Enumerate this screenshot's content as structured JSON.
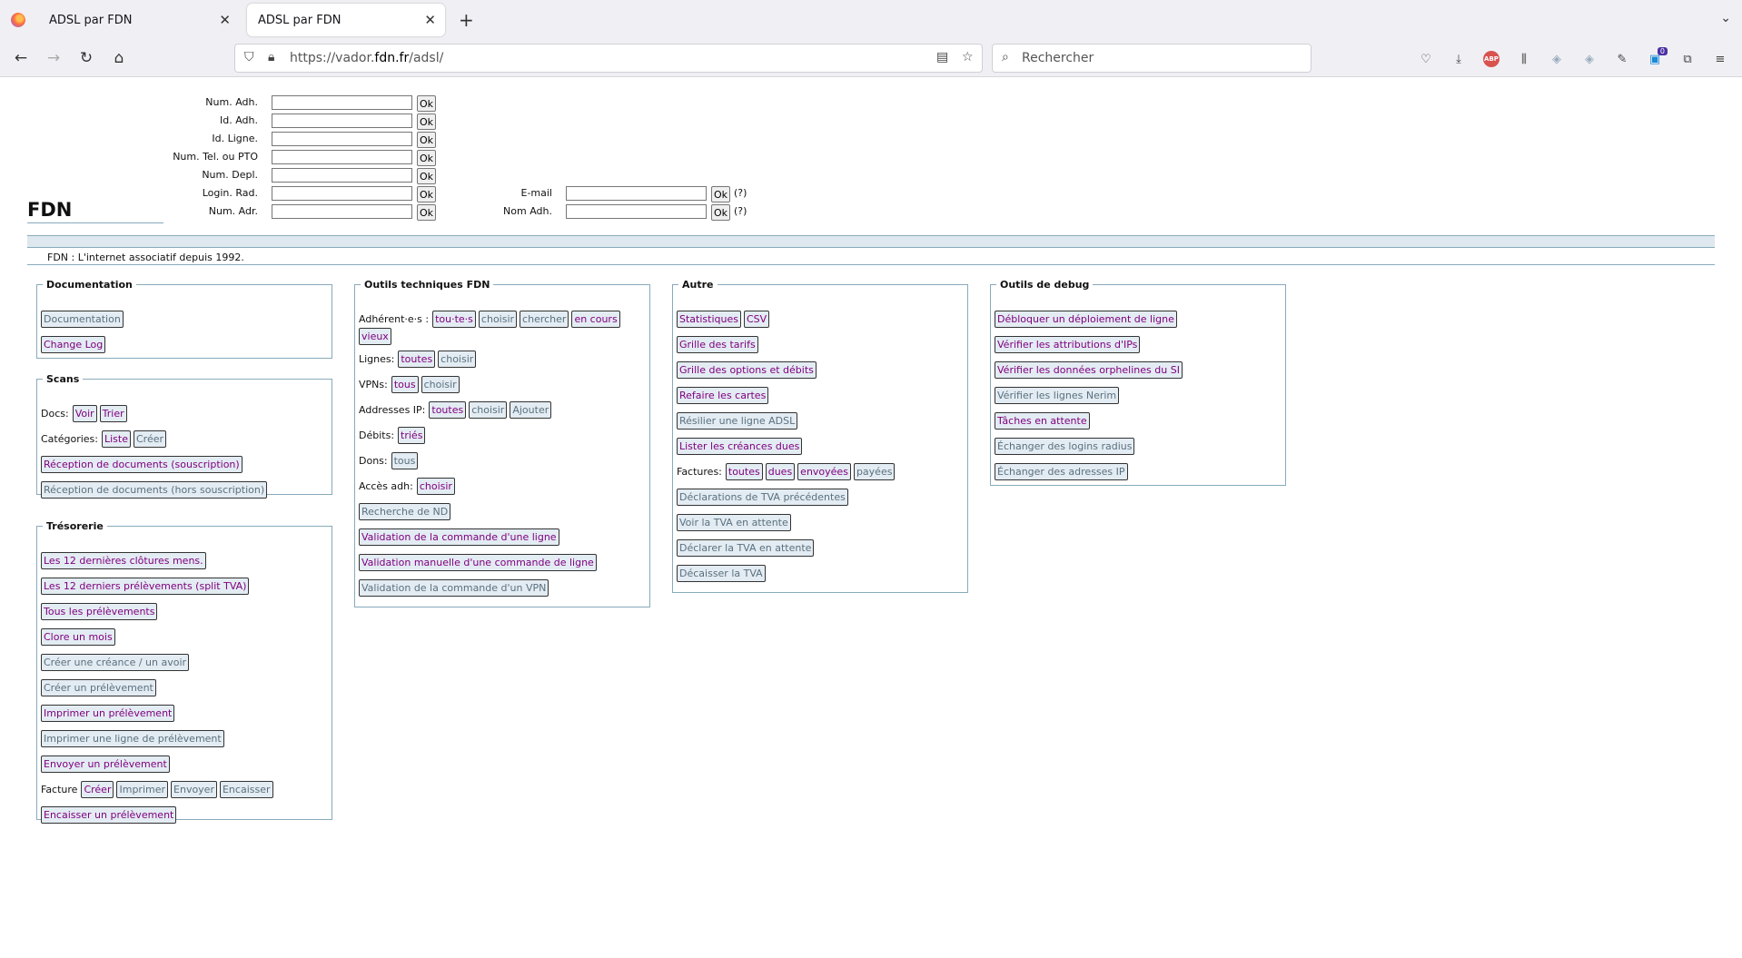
{
  "browser": {
    "tabs": [
      {
        "title": "ADSL par FDN",
        "active": false
      },
      {
        "title": "ADSL par FDN",
        "active": true
      }
    ],
    "url_prefix": "https://vador.",
    "url_domain": "fdn.fr",
    "url_path": "/adsl/",
    "search_placeholder": "Rechercher",
    "ext_badge": "0",
    "abp_label": "ABP"
  },
  "search_form": {
    "left_fields": [
      {
        "label": "Num. Adh.",
        "value": "",
        "ok": "Ok"
      },
      {
        "label": "Id. Adh.",
        "value": "",
        "ok": "Ok"
      },
      {
        "label": "Id. Ligne.",
        "value": "",
        "ok": "Ok"
      },
      {
        "label": "Num. Tel. ou PTO",
        "value": "",
        "ok": "Ok"
      },
      {
        "label": "Num. Depl.",
        "value": "",
        "ok": "Ok"
      },
      {
        "label": "Login. Rad.",
        "value": "",
        "ok": "Ok"
      },
      {
        "label": "Num. Adr.",
        "value": "",
        "ok": "Ok"
      }
    ],
    "right_fields": [
      {
        "label": "E-mail",
        "value": "",
        "ok": "Ok",
        "help": "(?)"
      },
      {
        "label": "Nom Adh.",
        "value": "",
        "ok": "Ok",
        "help": "(?)"
      }
    ]
  },
  "site": {
    "title": "FDN",
    "tagline": "FDN : L'internet associatif depuis 1992."
  },
  "sections": {
    "documentation": {
      "legend": "Documentation",
      "rows": [
        {
          "buttons": [
            {
              "label": "Documentation",
              "visited": false
            }
          ]
        },
        {
          "buttons": [
            {
              "label": "Change Log",
              "visited": true
            }
          ]
        }
      ]
    },
    "scans": {
      "legend": "Scans",
      "rows": [
        {
          "label": "Docs:",
          "buttons": [
            {
              "label": "Voir",
              "visited": true
            },
            {
              "label": "Trier",
              "visited": true
            }
          ]
        },
        {
          "label": "Catégories:",
          "buttons": [
            {
              "label": "Liste",
              "visited": true
            },
            {
              "label": "Créer",
              "visited": false
            }
          ]
        },
        {
          "buttons": [
            {
              "label": "Réception de documents (souscription)",
              "visited": true
            }
          ]
        },
        {
          "buttons": [
            {
              "label": "Réception de documents (hors souscription)",
              "visited": false
            }
          ]
        }
      ]
    },
    "tresorerie": {
      "legend": "Trésorerie",
      "rows": [
        {
          "buttons": [
            {
              "label": "Les 12 dernières clôtures mens.",
              "visited": true
            }
          ]
        },
        {
          "buttons": [
            {
              "label": "Les 12 derniers prélèvements (split TVA)",
              "visited": true
            }
          ]
        },
        {
          "buttons": [
            {
              "label": "Tous les prélèvements",
              "visited": true
            }
          ]
        },
        {
          "buttons": [
            {
              "label": "Clore un mois",
              "visited": true
            }
          ]
        },
        {
          "buttons": [
            {
              "label": "Créer une créance / un avoir",
              "visited": false
            }
          ]
        },
        {
          "buttons": [
            {
              "label": "Créer un prélèvement",
              "visited": false
            }
          ]
        },
        {
          "buttons": [
            {
              "label": "Imprimer un prélèvement",
              "visited": true
            }
          ]
        },
        {
          "buttons": [
            {
              "label": "Imprimer une ligne de prélèvement",
              "visited": false
            }
          ]
        },
        {
          "buttons": [
            {
              "label": "Envoyer un prélèvement",
              "visited": true
            }
          ]
        },
        {
          "label": "Facture",
          "buttons": [
            {
              "label": "Créer",
              "visited": true
            },
            {
              "label": "Imprimer",
              "visited": false
            },
            {
              "label": "Envoyer",
              "visited": false
            },
            {
              "label": "Encaisser",
              "visited": false
            }
          ]
        },
        {
          "buttons": [
            {
              "label": "Encaisser un prélèvement",
              "visited": true
            }
          ]
        }
      ]
    },
    "outils_techniques": {
      "legend": "Outils techniques FDN",
      "adherents_label": "Adhérent·e·s :",
      "adherents_buttons": [
        {
          "label": "tou·te·s",
          "visited": true
        },
        {
          "label": "choisir",
          "visited": false
        },
        {
          "label": "chercher",
          "visited": false
        },
        {
          "label": "en cours",
          "visited": true
        },
        {
          "label": "vieux",
          "visited": true
        }
      ],
      "rows": [
        {
          "label": "Lignes:",
          "buttons": [
            {
              "label": "toutes",
              "visited": true
            },
            {
              "label": "choisir",
              "visited": false
            }
          ]
        },
        {
          "label": "VPNs:",
          "buttons": [
            {
              "label": "tous",
              "visited": true
            },
            {
              "label": "choisir",
              "visited": false
            }
          ]
        },
        {
          "label": "Addresses IP:",
          "buttons": [
            {
              "label": "toutes",
              "visited": true
            },
            {
              "label": "choisir",
              "visited": false
            },
            {
              "label": "Ajouter",
              "visited": false
            }
          ]
        },
        {
          "label": "Débits:",
          "buttons": [
            {
              "label": "triés",
              "visited": true
            }
          ]
        },
        {
          "label": "Dons:",
          "buttons": [
            {
              "label": "tous",
              "visited": false
            }
          ]
        },
        {
          "label": "Accès adh:",
          "buttons": [
            {
              "label": "choisir",
              "visited": true
            }
          ]
        },
        {
          "buttons": [
            {
              "label": "Recherche de ND",
              "visited": false
            }
          ]
        },
        {
          "buttons": [
            {
              "label": "Validation de la commande d'une ligne",
              "visited": true
            }
          ]
        },
        {
          "buttons": [
            {
              "label": "Validation manuelle d'une commande de ligne",
              "visited": true
            }
          ]
        },
        {
          "buttons": [
            {
              "label": "Validation de la commande d'un VPN",
              "visited": false
            }
          ]
        }
      ]
    },
    "autre": {
      "legend": "Autre",
      "rows": [
        {
          "buttons": [
            {
              "label": "Statistiques",
              "visited": true
            },
            {
              "label": "CSV",
              "visited": true
            }
          ]
        },
        {
          "buttons": [
            {
              "label": "Grille des tarifs",
              "visited": true
            }
          ]
        },
        {
          "buttons": [
            {
              "label": "Grille des options et débits",
              "visited": true
            }
          ]
        },
        {
          "buttons": [
            {
              "label": "Refaire les cartes",
              "visited": true
            }
          ]
        },
        {
          "buttons": [
            {
              "label": "Résilier une ligne ADSL",
              "visited": false
            }
          ]
        },
        {
          "buttons": [
            {
              "label": "Lister les créances dues",
              "visited": true
            }
          ]
        },
        {
          "label": "Factures:",
          "buttons": [
            {
              "label": "toutes",
              "visited": true
            },
            {
              "label": "dues",
              "visited": true
            },
            {
              "label": "envoyées",
              "visited": true
            },
            {
              "label": "payées",
              "visited": false
            }
          ]
        },
        {
          "buttons": [
            {
              "label": "Déclarations de TVA précédentes",
              "visited": false
            }
          ]
        },
        {
          "buttons": [
            {
              "label": "Voir la TVA en attente",
              "visited": false
            }
          ]
        },
        {
          "buttons": [
            {
              "label": "Déclarer la TVA en attente",
              "visited": false
            }
          ]
        },
        {
          "buttons": [
            {
              "label": "Décaisser la TVA",
              "visited": false
            }
          ]
        }
      ]
    },
    "debug": {
      "legend": "Outils de debug",
      "rows": [
        {
          "buttons": [
            {
              "label": "Débloquer un déploiement de ligne",
              "visited": true
            }
          ]
        },
        {
          "buttons": [
            {
              "label": "Vérifier les attributions d'IPs",
              "visited": true
            }
          ]
        },
        {
          "buttons": [
            {
              "label": "Vérifier les données orphelines du SI",
              "visited": true
            }
          ]
        },
        {
          "buttons": [
            {
              "label": "Vérifier les lignes Nerim",
              "visited": false
            }
          ]
        },
        {
          "buttons": [
            {
              "label": "Tâches en attente",
              "visited": true
            }
          ]
        },
        {
          "buttons": [
            {
              "label": "Échanger des logins radius",
              "visited": false
            }
          ]
        },
        {
          "buttons": [
            {
              "label": "Échanger des adresses IP",
              "visited": false
            }
          ]
        }
      ]
    }
  }
}
